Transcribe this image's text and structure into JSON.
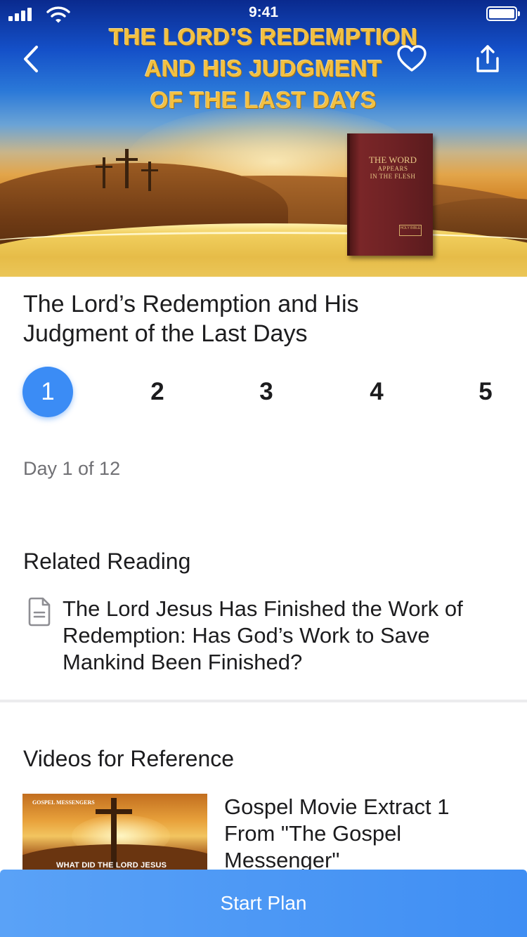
{
  "status_bar": {
    "time": "9:41"
  },
  "hero": {
    "title_line1": "THE LORD’S REDEMPTION",
    "title_line2": "AND HIS JUDGMENT",
    "title_line3": "OF THE LAST DAYS",
    "book": {
      "line1": "THE WORD",
      "line2": "APPEARS",
      "line3": "IN THE FLESH",
      "badge": "HOLY BIBLE"
    }
  },
  "nav": {
    "back_icon": "chevron-left-icon",
    "favorite_icon": "heart-icon",
    "share_icon": "share-icon"
  },
  "plan": {
    "title": "The Lord’s Redemption and His Judgment of the Last Days",
    "days": [
      "1",
      "2",
      "3",
      "4",
      "5"
    ],
    "active_day": "1",
    "progress": "Day 1 of 12"
  },
  "related_reading": {
    "heading": "Related Reading",
    "items": [
      {
        "icon": "document-icon",
        "title": "The Lord Jesus Has Finished the Work of Redemption: Has God’s Work to Save Mankind Been Finished?"
      }
    ]
  },
  "videos": {
    "heading": "Videos for Reference",
    "items": [
      {
        "title": "Gospel Movie Extract 1 From \"The Gospel Messenger\"",
        "thumb_logo": "GOSPEL MESSENGERS",
        "thumb_caption": "WHAT DID THE LORD JESUS"
      }
    ]
  },
  "footer": {
    "start_label": "Start Plan"
  },
  "colors": {
    "accent": "#3b8cf5",
    "hero_gold": "#f3c142",
    "book": "#6d2124"
  }
}
